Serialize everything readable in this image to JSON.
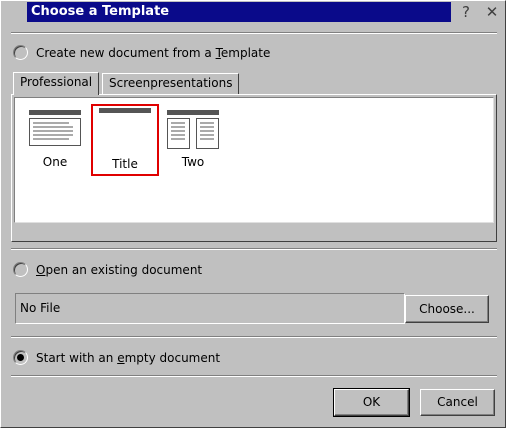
{
  "window": {
    "title": "Choose a Template",
    "help_glyph": "?",
    "close_glyph": "✕"
  },
  "template_option": {
    "label_before": "Create new document from a ",
    "label_mnemonic": "T",
    "label_after": "emplate",
    "checked": false
  },
  "tabs": [
    {
      "label": "Professional",
      "active": true
    },
    {
      "label": "Screenpresentations",
      "active": false
    }
  ],
  "templates": [
    {
      "name": "One",
      "icon": "single-column-doc-icon",
      "selected": false
    },
    {
      "name": "Title",
      "icon": "title-only-doc-icon",
      "selected": true
    },
    {
      "name": "Two",
      "icon": "two-column-doc-icon",
      "selected": false
    }
  ],
  "open_option": {
    "label_mnemonic": "O",
    "label_after": "pen an existing document",
    "checked": false
  },
  "file_field": {
    "value": "No File"
  },
  "choose_button": {
    "label": "Choose..."
  },
  "empty_option": {
    "label_before": "Start with an ",
    "label_mnemonic": "e",
    "label_after": "mpty document",
    "checked": true
  },
  "buttons": {
    "ok": "OK",
    "cancel": "Cancel"
  },
  "colors": {
    "titlebar": "#0a0a8a",
    "selection_border": "#e00000",
    "face": "#c0c0c0"
  }
}
